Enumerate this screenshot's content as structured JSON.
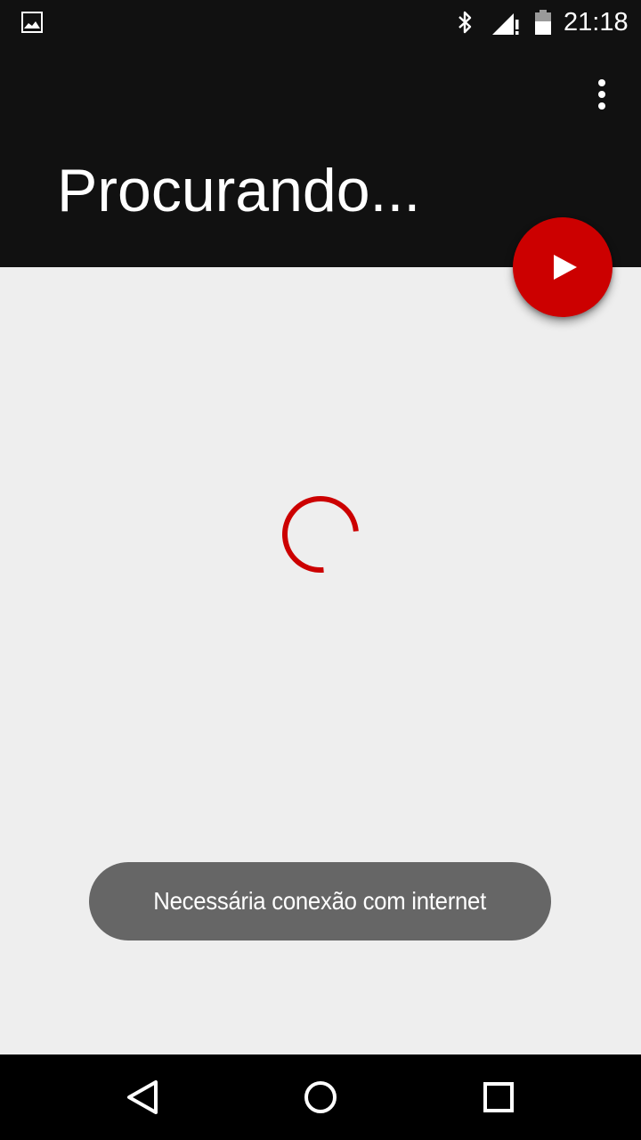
{
  "status_bar": {
    "time": "21:18",
    "icons": [
      "image-notification-icon",
      "bluetooth-icon",
      "signal-no-data-icon",
      "battery-icon"
    ]
  },
  "app_bar": {
    "title": "Procurando...",
    "overflow_icon": "more-vert-icon"
  },
  "fab": {
    "icon": "play-icon",
    "color": "#cc0000"
  },
  "main": {
    "spinner_color": "#cc0000"
  },
  "toast": {
    "message": "Necessária conexão com internet"
  },
  "nav_bar": {
    "buttons": [
      "back-icon",
      "home-icon",
      "recents-icon"
    ]
  },
  "colors": {
    "app_bar": "#111111",
    "background": "#eeeeee",
    "accent": "#cc0000",
    "toast": "#666666"
  }
}
